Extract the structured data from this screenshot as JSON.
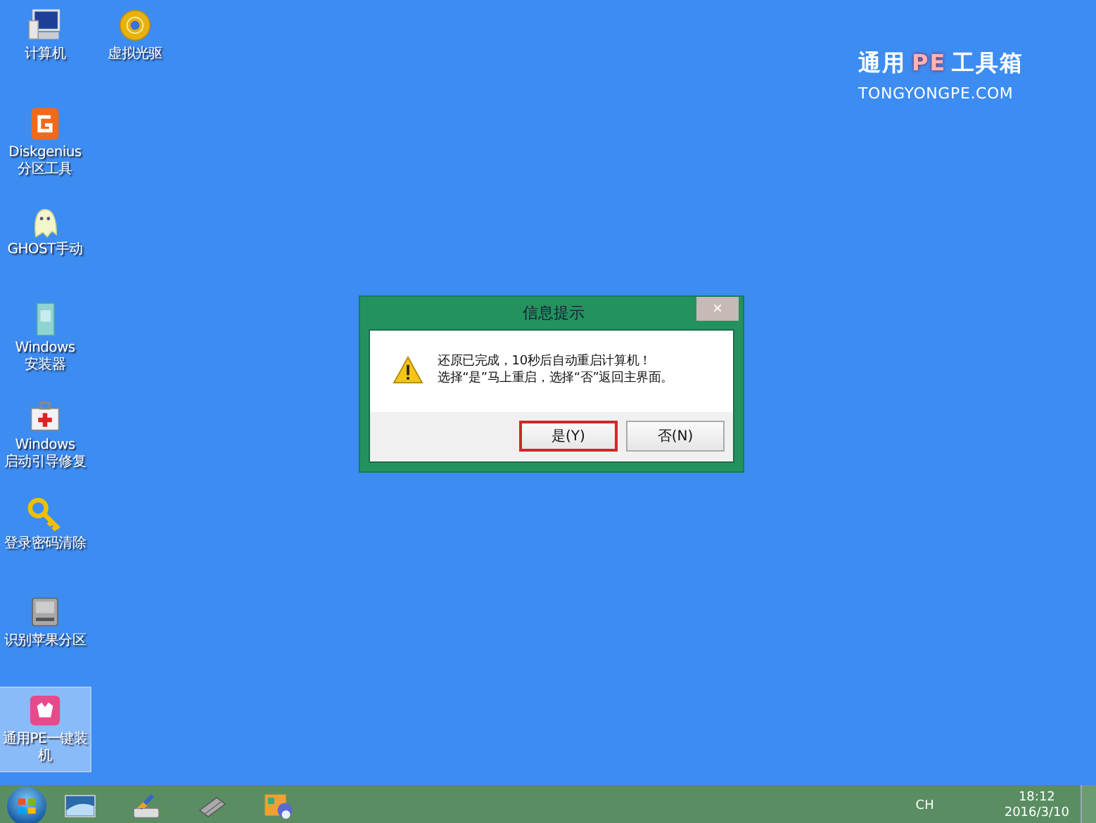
{
  "desktop_icons": [
    {
      "kind": "computer",
      "label": "计算机",
      "selected": false
    },
    {
      "kind": "disc",
      "label": "虚拟光驱",
      "selected": false
    },
    {
      "kind": "diskgenius",
      "label": "Diskgenius\n分区工具",
      "selected": false
    },
    {
      "kind": "ghost",
      "label": "GHOST手动",
      "selected": false
    },
    {
      "kind": "installer",
      "label": "Windows\n安装器",
      "selected": false
    },
    {
      "kind": "toolbox",
      "label": "Windows\n启动引导修复",
      "selected": false
    },
    {
      "kind": "key",
      "label": "登录密码清除",
      "selected": false
    },
    {
      "kind": "drive",
      "label": "识别苹果分区",
      "selected": false
    },
    {
      "kind": "pe",
      "label": "通用PE一键装机",
      "selected": true
    }
  ],
  "logo": {
    "title_parts": [
      {
        "text": "通用",
        "highlight": false
      },
      {
        "text": "PE",
        "highlight": true
      },
      {
        "text": "工具箱",
        "highlight": false
      }
    ],
    "subtitle": "TONGYONGPE.COM"
  },
  "dialog": {
    "title": "信息提示",
    "close": "×",
    "lines": [
      "还原已完成，10秒后自动重启计算机！",
      "选择“是”马上重启，选择“否”返回主界面。"
    ],
    "buttons": [
      {
        "label": "是(Y)",
        "selected": true
      },
      {
        "label": "否(N)",
        "selected": false
      }
    ]
  },
  "taskbar": {
    "items": [
      {
        "kind": "screen"
      },
      {
        "kind": "brush-drive"
      },
      {
        "kind": "chip"
      },
      {
        "kind": "tools"
      }
    ],
    "language": "CH",
    "time": "18:12",
    "date": "2016/3/10"
  }
}
